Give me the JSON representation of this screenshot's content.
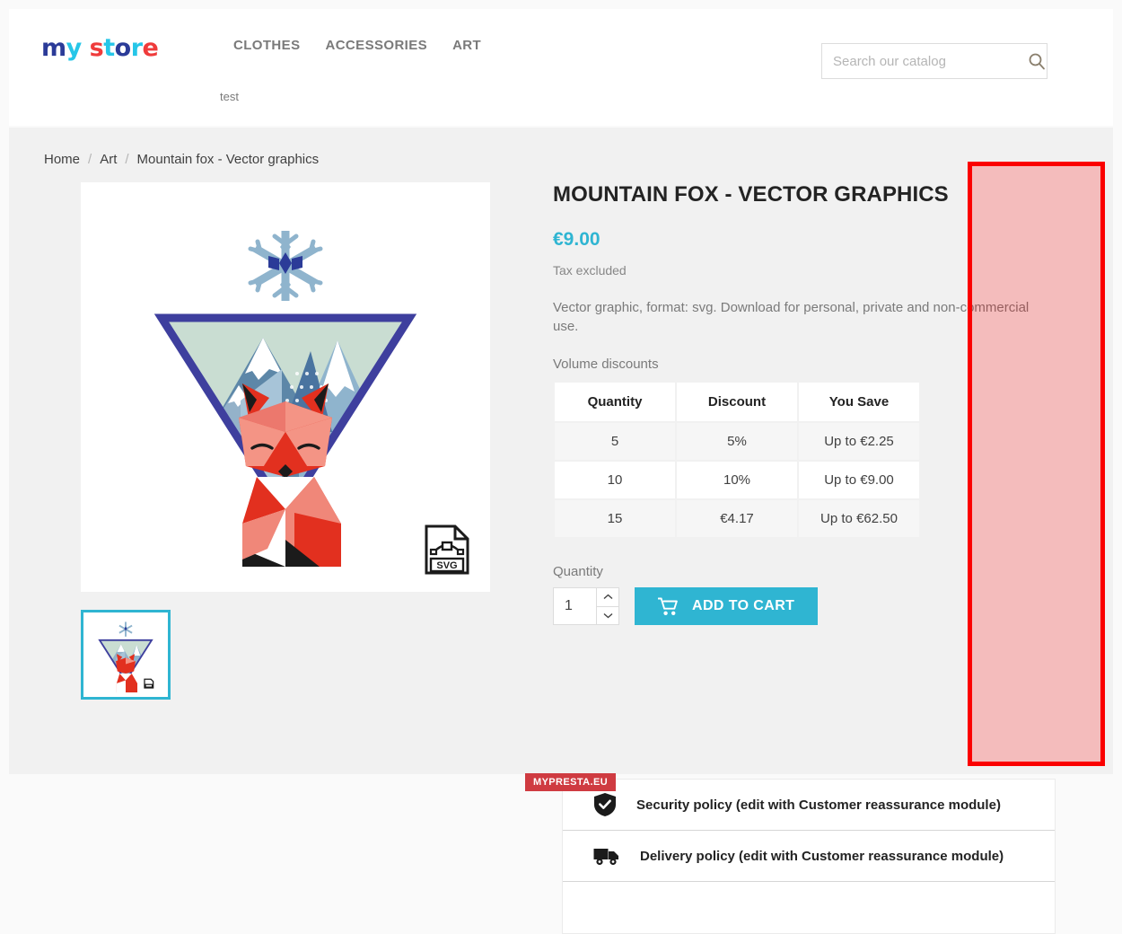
{
  "header": {
    "logo": {
      "text": "my store",
      "letters": [
        {
          "ch": "m",
          "color": "#2b3b98"
        },
        {
          "ch": "y",
          "color": "#26c6e8"
        },
        {
          "ch": " ",
          "color": "#ffffff"
        },
        {
          "ch": "s",
          "color": "#ef3b3b"
        },
        {
          "ch": "t",
          "color": "#26c6e8"
        },
        {
          "ch": "o",
          "color": "#2b3b98"
        },
        {
          "ch": "r",
          "color": "#26c6e8"
        },
        {
          "ch": "e",
          "color": "#ef3b3b"
        }
      ]
    },
    "nav": [
      {
        "label": "CLOTHES"
      },
      {
        "label": "ACCESSORIES"
      },
      {
        "label": "ART"
      }
    ],
    "subnav": [
      {
        "label": "test"
      }
    ],
    "search": {
      "placeholder": "Search our catalog",
      "value": "",
      "icon": "search-icon"
    }
  },
  "breadcrumb": [
    {
      "label": "Home",
      "current": false
    },
    {
      "label": "Art",
      "current": false
    },
    {
      "label": "Mountain fox - Vector graphics",
      "current": true
    }
  ],
  "breadcrumb_separator": "/",
  "gallery": {
    "main_image_alt": "Mountain fox - Vector graphics",
    "svg_badge_label": "SVG",
    "thumbnails": [
      {
        "alt": "Mountain fox - Vector graphics thumbnail",
        "selected": true
      }
    ]
  },
  "product": {
    "title": "Mountain fox - Vector graphics",
    "price": "€9.00",
    "tax_note": "Tax excluded",
    "description": "Vector graphic, format: svg. Download for personal, private and non-commercial use.",
    "discounts_label": "Volume discounts",
    "discount_table": {
      "columns": [
        "Quantity",
        "Discount",
        "You Save"
      ],
      "rows": [
        [
          "5",
          "5%",
          "Up to €2.25"
        ],
        [
          "10",
          "10%",
          "Up to €9.00"
        ],
        [
          "15",
          "€4.17",
          "Up to €62.50"
        ]
      ]
    },
    "quantity_label": "Quantity",
    "quantity_value": "1",
    "add_to_cart_label": "Add to cart"
  },
  "reassurance": [
    {
      "icon": "shield-check-icon",
      "text": "Security policy (edit with Customer reassurance module)"
    },
    {
      "icon": "truck-icon",
      "text": "Delivery policy (edit with Customer reassurance module)"
    },
    {
      "icon": "return-icon",
      "text": ""
    }
  ],
  "footer": {
    "badge": "MYPRESTA.EU"
  },
  "colors": {
    "accent": "#2fb5d2",
    "annotation_border": "#fb0000",
    "annotation_fill": "rgba(255,0,0,0.22)",
    "badge_bg": "#cf3b41",
    "page_bg": "#f1f1f1"
  }
}
